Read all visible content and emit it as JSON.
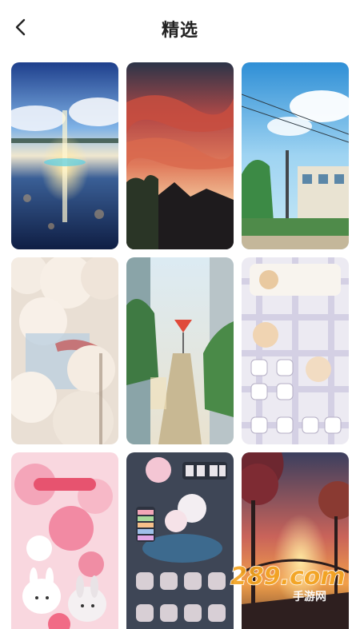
{
  "header": {
    "title": "精选",
    "back_icon": "chevron-left-icon"
  },
  "wallpapers": [
    {
      "name": "wallpaper-sky-reflection-lake"
    },
    {
      "name": "wallpaper-red-sunset-clouds"
    },
    {
      "name": "wallpaper-anime-town-power-lines"
    },
    {
      "name": "wallpaper-cherry-blossom-street"
    },
    {
      "name": "wallpaper-sunny-alley-stop-sign"
    },
    {
      "name": "wallpaper-cute-bear-phone-theme"
    },
    {
      "name": "wallpaper-pink-bunny-sticker"
    },
    {
      "name": "wallpaper-cute-whale-phone-theme"
    },
    {
      "name": "wallpaper-sunset-forest-bridge"
    }
  ],
  "watermark": {
    "logo_text": "289.com",
    "subtitle": "手游网"
  }
}
